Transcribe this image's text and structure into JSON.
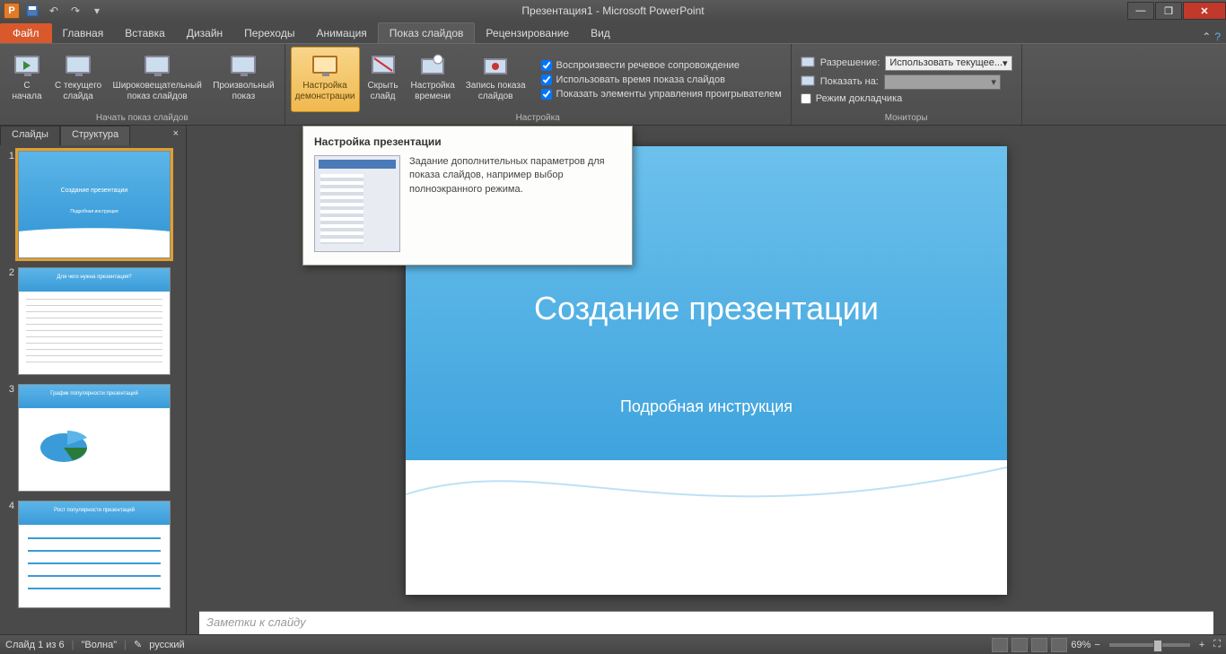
{
  "titlebar": {
    "title": "Презентация1 - Microsoft PowerPoint",
    "app_letter": "P"
  },
  "tabs": {
    "file": "Файл",
    "items": [
      "Главная",
      "Вставка",
      "Дизайн",
      "Переходы",
      "Анимация",
      "Показ слайдов",
      "Рецензирование",
      "Вид"
    ],
    "active_index": 5
  },
  "ribbon": {
    "group_start": {
      "label": "Начать показ слайдов",
      "from_beginning": "С\nначала",
      "from_current": "С текущего\nслайда",
      "broadcast": "Широковещательный\nпоказ слайдов",
      "custom": "Произвольный\nпоказ"
    },
    "group_setup": {
      "label": "Настройка",
      "setup_show": "Настройка\nдемонстрации",
      "hide_slide": "Скрыть\nслайд",
      "rehearse": "Настройка\nвремени",
      "record": "Запись показа\nслайдов",
      "chk_narration": "Воспроизвести речевое сопровождение",
      "chk_timings": "Использовать время показа слайдов",
      "chk_media": "Показать элементы управления проигрывателем"
    },
    "group_monitors": {
      "label": "Мониторы",
      "resolution_label": "Разрешение:",
      "resolution_value": "Использовать текущее...",
      "show_on_label": "Показать на:",
      "show_on_value": "",
      "presenter_view": "Режим докладчика"
    }
  },
  "tooltip": {
    "title": "Настройка презентации",
    "text": "Задание дополнительных параметров для показа слайдов, например выбор полноэкранного режима."
  },
  "slidepanel": {
    "tab_slides": "Слайды",
    "tab_outline": "Структура",
    "thumbs": [
      {
        "title": "Создание презентации",
        "subtitle": "Подробная инструкция"
      },
      {
        "title": "Для чего нужна презентация?"
      },
      {
        "title": "График популярности презентаций"
      },
      {
        "title": "Рост популярности презентаций"
      }
    ],
    "selected": 0
  },
  "slide": {
    "title": "Создание презентации",
    "subtitle": "Подробная инструкция"
  },
  "notes": {
    "placeholder": "Заметки к слайду"
  },
  "statusbar": {
    "slide_info": "Слайд 1 из 6",
    "theme": "\"Волна\"",
    "language": "русский",
    "zoom": "69%"
  }
}
